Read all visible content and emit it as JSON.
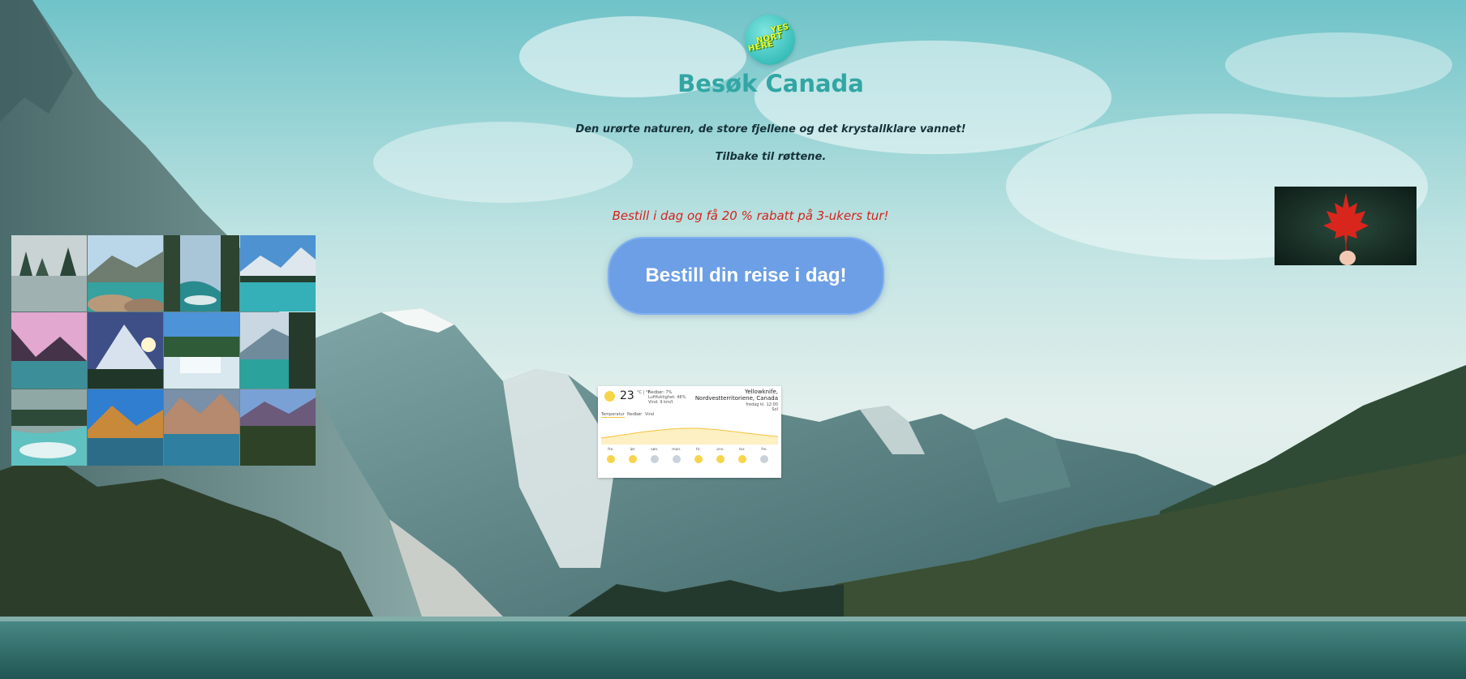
{
  "site": {
    "title": "Besøk Canada",
    "logo_text": [
      "YES",
      "NORT",
      "HERE"
    ],
    "tagline": "Den urørte naturen, de store fjellene og det krystallklare vannet!",
    "subtagline": "Tilbake til røttene.",
    "offer": "Bestill i dag og få 20 % rabatt på 3-ukers tur!",
    "cta_label": "Bestill din reise i dag!"
  },
  "gallery": {
    "tiles": [
      "foggy-lake",
      "rocky-lake",
      "forest-river",
      "turquoise-lake",
      "pink-sky-lake",
      "sunlit-peak",
      "waterfall",
      "emerald-lake",
      "river-rapids",
      "autumn-lake",
      "mountain-reflection",
      "valley-forest"
    ]
  },
  "weather": {
    "temp": "23",
    "unit": "°C | °F",
    "details": [
      "Nedbør: 7%",
      "Luftfuktighet: 46%",
      "Vind: 9 km/t"
    ],
    "location": "Yellowknife,",
    "region": "Nordvestterritoriene, Canada",
    "time": "fredag kl. 12:00",
    "condition": "Sol",
    "tabs": [
      "Temperatur",
      "Nedbør",
      "Vind"
    ],
    "days": [
      "fre.",
      "lør.",
      "søn.",
      "man.",
      "tir.",
      "ons.",
      "tor.",
      "fre."
    ]
  },
  "colors": {
    "title": "#32a6a4",
    "offer": "#d4231c",
    "button": "#6c9fe6"
  }
}
